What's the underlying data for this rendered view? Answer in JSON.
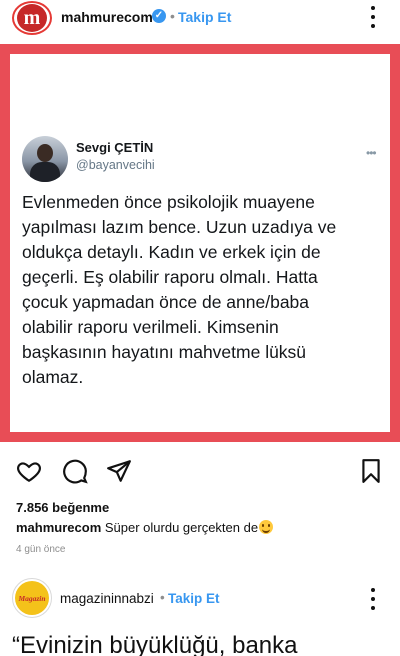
{
  "post1": {
    "avatar_letter": "m",
    "username": "mahmurecom",
    "separator": "•",
    "follow_label": "Takip Et",
    "image": {
      "border_color": "#e84d56",
      "tweet": {
        "name": "Sevgi ÇETİN",
        "handle": "@bayanvecihi",
        "more": "•••",
        "text": "Evlenmeden önce psikolojik muayene\nyapılması lazım bence. Uzun uzadıya ve\noldukça detaylı. Kadın ve erkek için de\ngeçerli. Eş olabilir raporu olmalı. Hatta\nçocuk yapmadan önce de anne/baba\nolabilir raporu verilmeli. Kimsenin\nbaşkasının hayatını mahvetme lüksü\nolamaz."
      }
    },
    "likes": "7.856 beğenme",
    "caption": {
      "username": "mahmurecom",
      "text": " Süper olurdu gerçekten de"
    },
    "time": "4 gün önce"
  },
  "post2": {
    "avatar_text": "Magazin",
    "username": "magazininnabzi",
    "separator": "•",
    "follow_label": "Takip Et",
    "text_preview": "“Evinizin büyüklüğü, banka"
  },
  "colors": {
    "accent": "#3897f0",
    "brand_red": "#c62828"
  }
}
